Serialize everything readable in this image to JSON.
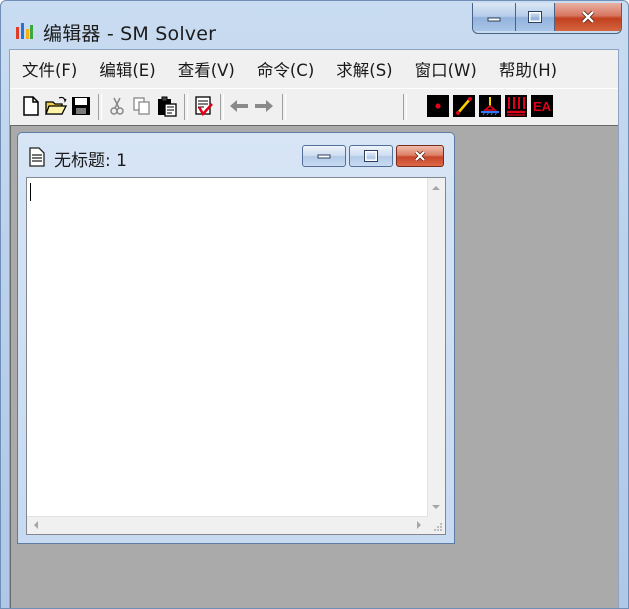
{
  "window": {
    "title": "编辑器 - SM Solver",
    "controls": {
      "minimize": "minimize-icon",
      "maximize": "maximize-icon",
      "close": "close-icon"
    }
  },
  "menu": {
    "items": [
      {
        "label": "文件(F)",
        "hotkey": "F"
      },
      {
        "label": "编辑(E)",
        "hotkey": "E"
      },
      {
        "label": "查看(V)",
        "hotkey": "V"
      },
      {
        "label": "命令(C)",
        "hotkey": "C"
      },
      {
        "label": "求解(S)",
        "hotkey": "S"
      },
      {
        "label": "窗口(W)",
        "hotkey": "W"
      },
      {
        "label": "帮助(H)",
        "hotkey": "H"
      }
    ]
  },
  "toolbar": {
    "buttons": [
      "new-file-icon",
      "open-folder-icon",
      "save-disk-icon",
      "cut-icon",
      "copy-icon",
      "paste-icon",
      "edit-check-icon",
      "back-arrow-icon",
      "forward-arrow-icon",
      "point-tool-icon",
      "line-tool-icon",
      "support-tool-icon",
      "load-tool-icon",
      "ea-tool-icon"
    ],
    "ea_label": "EA"
  },
  "document": {
    "title": "无标题: 1",
    "content": ""
  },
  "colors": {
    "tool_red": "#e0001b",
    "tool_black": "#000000",
    "mdi_background": "#abaaab"
  }
}
